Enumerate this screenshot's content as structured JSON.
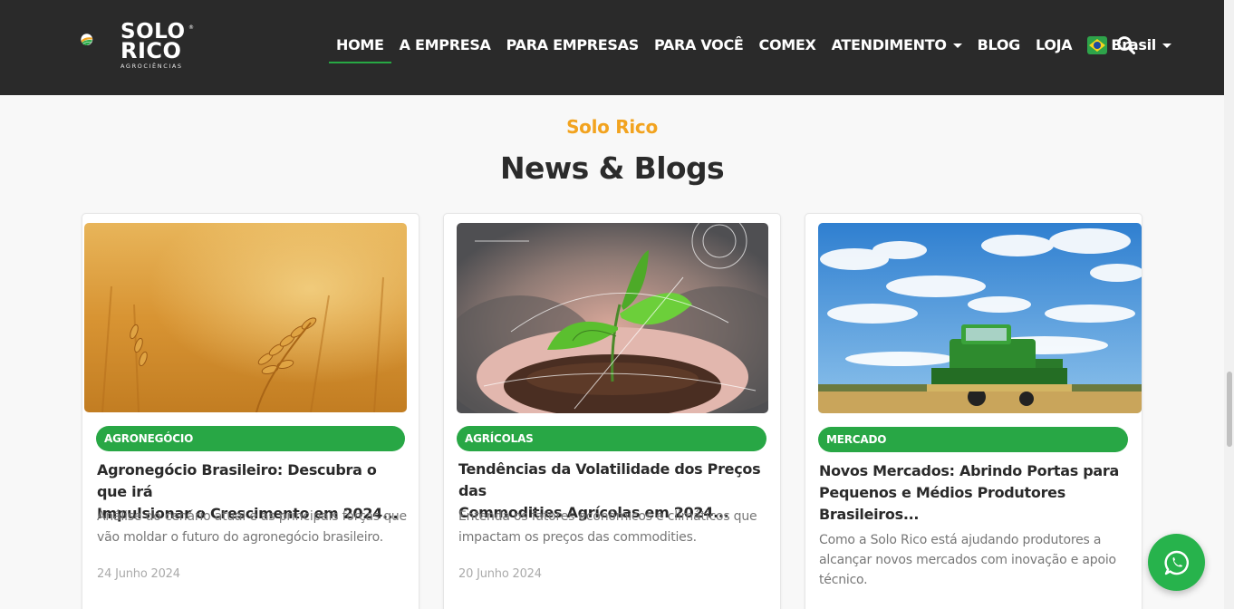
{
  "header": {
    "logo_line1": "SOLO",
    "logo_line2": "RICO",
    "logo_sub": "AGROCIÊNCIAS",
    "logo_reg": "®",
    "nav": [
      {
        "label": "HOME",
        "active": true
      },
      {
        "label": "A EMPRESA"
      },
      {
        "label": "PARA EMPRESAS"
      },
      {
        "label": "PARA VOCÊ"
      },
      {
        "label": "COMEX"
      },
      {
        "label": "ATENDIMENTO",
        "dropdown": true
      },
      {
        "label": "BLOG"
      },
      {
        "label": "LOJA"
      }
    ],
    "language": "Brasil",
    "search_icon": "search-icon"
  },
  "section": {
    "eyebrow": "Solo Rico",
    "title": "News & Blogs"
  },
  "cards": [
    {
      "image": "wheat-field-image",
      "category": "AGRONEGÓCIO",
      "title_line1": "Agronegócio Brasileiro: Descubra o que irá",
      "title_line2": "Impulsionar o Crescimento em 2024...",
      "excerpt_line1": "Análise do cenário atual e as principais forças que",
      "excerpt_line2": "vão moldar o futuro do agronegócio brasileiro.",
      "date": "24 Junho 2024"
    },
    {
      "image": "plant-in-hands-image",
      "category": "AGRÍCOLAS",
      "title_line1": "Tendências da Volatilidade dos Preços das",
      "title_line2": "Commodities Agrícolas em 2024...",
      "excerpt_line1": "Entenda os fatores econômicos e climáticos que",
      "excerpt_line2": "impactam os preços das commodities.",
      "date": "20 Junho 2024"
    },
    {
      "image": "combine-harvester-image",
      "category": "MERCADO",
      "title_line1": "Novos Mercados: Abrindo Portas para",
      "title_line2": "Pequenos e Médios Produtores",
      "title_line3": "Brasileiros...",
      "excerpt_line1": "Como a Solo Rico está ajudando produtores a",
      "excerpt_line2": "alcançar novos mercados com inovação e apoio",
      "excerpt_line3": "técnico."
    }
  ],
  "colors": {
    "header_bg": "#2a2a2a",
    "accent_green": "#28a745",
    "eyebrow_orange": "#f2a31f",
    "whatsapp": "#27b34c"
  }
}
